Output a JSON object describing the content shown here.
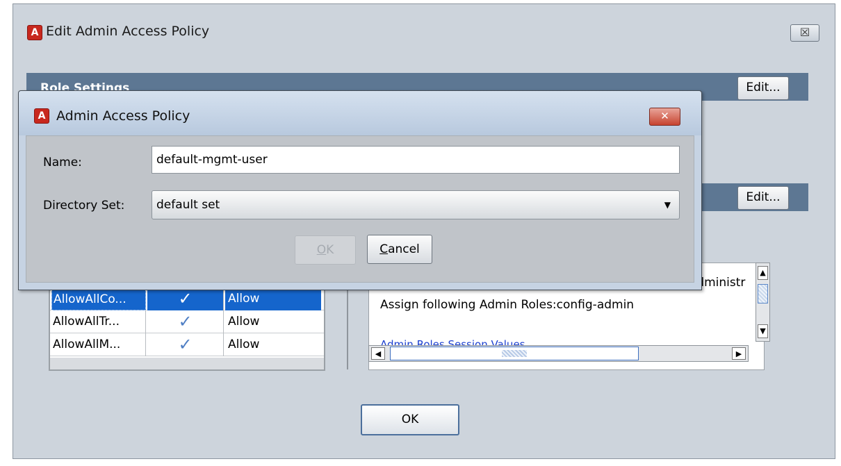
{
  "outer_window": {
    "icon": "A",
    "title": "Edit Admin Access Policy",
    "close_glyph": "☒",
    "role_settings_header": "Role Settings",
    "edit_label": "Edit...",
    "ok_label": "OK",
    "rules_table": {
      "rows": [
        {
          "name": "AllowAllCo...",
          "enabled": "✓",
          "action": "Allow",
          "selected": true
        },
        {
          "name": "AllowAllTr...",
          "enabled": "✓",
          "action": "Allow",
          "selected": false
        },
        {
          "name": "AllowAllM...",
          "enabled": "✓",
          "action": "Allow",
          "selected": false
        }
      ]
    },
    "text_panel": {
      "lines": [
        "Administr",
        "Assign following Admin Roles:config-admin",
        "Admin Roles Session Values"
      ]
    },
    "scroll_glyphs": {
      "up": "▲",
      "down": "▼",
      "left": "◀",
      "right": "▶"
    }
  },
  "dialog": {
    "icon": "A",
    "title": "Admin Access Policy",
    "close_glyph": "✕",
    "name_label": "Name:",
    "name_value": "default-mgmt-user",
    "directory_label": "Directory Set:",
    "directory_value": "default set",
    "dropdown_glyph": "▼",
    "ok_mnemonic": "O",
    "ok_rest": "K",
    "cancel_mnemonic": "C",
    "cancel_rest": "ancel"
  },
  "colors": {
    "section_header": "#5d7793",
    "selection": "#1565cc",
    "close_red": "#c7432f",
    "link_blue": "#1b3fd0"
  }
}
